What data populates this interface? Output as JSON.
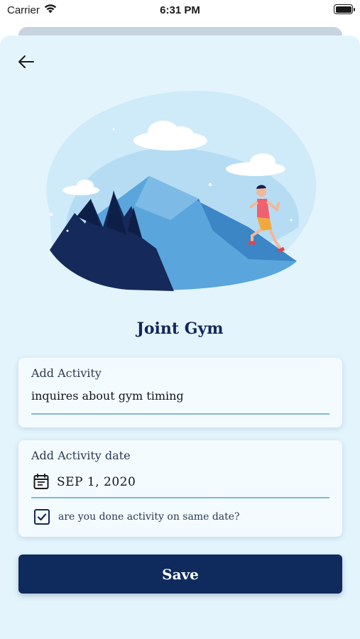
{
  "status_bar": {
    "carrier": "Carrier",
    "time": "6:31 PM"
  },
  "icons": {
    "back": "arrow-left-icon",
    "wifi": "wifi-icon",
    "battery": "battery-icon",
    "calendar": "calendar-icon",
    "check": "check-icon"
  },
  "colors": {
    "background": "#e3f4fd",
    "primary": "#0f2a5c",
    "accent_line": "#7cbbd6"
  },
  "page": {
    "title": "Joint Gym"
  },
  "activity_card": {
    "label": "Add Activity",
    "value": "inquires about gym timing"
  },
  "date_card": {
    "label": "Add Activity date",
    "date_value": "SEP 1, 2020",
    "same_date_checked": true,
    "same_date_label": "are you done activity on same date?"
  },
  "save_button": {
    "label": "Save"
  }
}
